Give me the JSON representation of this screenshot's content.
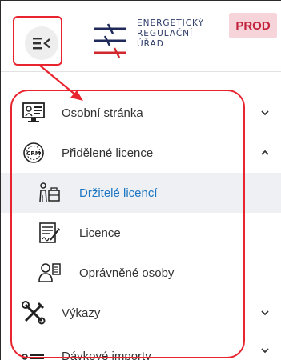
{
  "header": {
    "menu_icon": "menu-collapse-icon",
    "logo_line1": "ENERGETICKÝ",
    "logo_line2": "REGULAČNÍ",
    "logo_line3": "ÚŘAD",
    "env_badge": "PROD"
  },
  "nav": {
    "items": [
      {
        "label": "Osobní stránka",
        "icon": "personal-page-icon",
        "expanded": false
      },
      {
        "label": "Přidělené licence",
        "icon": "crm-icon",
        "expanded": true
      },
      {
        "label": "Držitelé licencí",
        "icon": "license-holders-icon",
        "active": true
      },
      {
        "label": "Licence",
        "icon": "license-document-icon"
      },
      {
        "label": "Oprávněné osoby",
        "icon": "authorized-persons-icon"
      },
      {
        "label": "Výkazy",
        "icon": "tools-icon",
        "expanded": false
      },
      {
        "label": "Dávkové importy",
        "icon": "batch-import-icon",
        "expanded": false
      }
    ]
  },
  "colors": {
    "highlight": "#e8252f",
    "active_text": "#1d76c2",
    "badge_bg": "#f6d4d9",
    "badge_text": "#c2243c"
  }
}
